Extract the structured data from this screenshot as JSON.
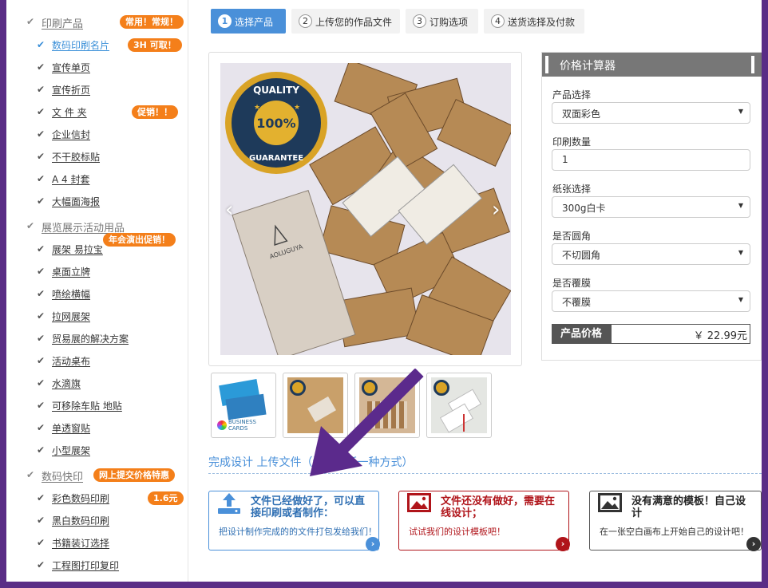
{
  "sidebar": {
    "categories": [
      {
        "label": "印刷产品",
        "badge": "常用！常规！"
      },
      {
        "label": "展览展示活动用品",
        "badge": "年会演出促销！"
      },
      {
        "label": "数码快印",
        "badge": "网上提交价格特惠"
      }
    ],
    "items": [
      {
        "label": "数码印刷名片",
        "badge": "3H 可取！"
      },
      {
        "label": "宣传单页"
      },
      {
        "label": "宣传折页"
      },
      {
        "label": "文 件 夹",
        "badge": "促销！！"
      },
      {
        "label": "企业信封"
      },
      {
        "label": "不干胶标贴"
      },
      {
        "label": "A 4 封套"
      },
      {
        "label": "大幅面海报"
      },
      {
        "label": "展架 易拉宝"
      },
      {
        "label": "桌面立牌"
      },
      {
        "label": "喷绘横幅"
      },
      {
        "label": "拉网展架"
      },
      {
        "label": "贸易展的解决方案"
      },
      {
        "label": "活动桌布"
      },
      {
        "label": "水滴旗"
      },
      {
        "label": "可移除车贴 地贴"
      },
      {
        "label": "单透窗贴"
      },
      {
        "label": "小型展架"
      },
      {
        "label": "彩色数码印刷",
        "badge": "1.6元"
      },
      {
        "label": "黑白数码印刷"
      },
      {
        "label": "书籍装订选择"
      },
      {
        "label": "工程图打印复印"
      }
    ]
  },
  "steps": [
    {
      "num": "1",
      "label": "选择产品"
    },
    {
      "num": "2",
      "label": "上传您的作品文件"
    },
    {
      "num": "3",
      "label": "订购选项"
    },
    {
      "num": "4",
      "label": "送货选择及付款"
    }
  ],
  "gallery": {
    "seal_top": "QUALITY",
    "seal_mid": "100%",
    "seal_bottom": "GUARANTEE",
    "card_brand": "AOLUGUYA",
    "thumb1_brand": "BUSINESS CARDS"
  },
  "calculator": {
    "title": "价格计算器",
    "fields": {
      "product": {
        "label": "产品选择",
        "value": "双面彩色"
      },
      "quantity": {
        "label": "印刷数量",
        "value": "1"
      },
      "paper": {
        "label": "纸张选择",
        "value": "300g白卡"
      },
      "corner": {
        "label": "是否圆角",
        "value": "不切圆角"
      },
      "laminate": {
        "label": "是否覆膜",
        "value": "不覆膜"
      }
    },
    "price_label": "产品价格",
    "price_value": "￥ 22.99元"
  },
  "upload": {
    "title": "完成设计 上传文件（请选择任一种方式）",
    "options": [
      {
        "heading": "文件已经做好了，可以直接印刷或者制作：",
        "desc": "把设计制作完成的的文件打包发给我们！"
      },
      {
        "heading": "文件还没有做好，需要在线设计；",
        "desc": "试试我们的设计模板吧！"
      },
      {
        "heading": "没有满意的模板！自己设计",
        "desc": "在一张空白画布上开始自己的设计吧！"
      }
    ]
  },
  "colors": {
    "frame_bg": "#5a2d86",
    "accent_blue": "#4a90d9",
    "badge_orange": "#f47f1a",
    "option_red": "#b0141a",
    "arrow_purple": "#5b2a8c"
  },
  "icons": {
    "check": "check-icon",
    "upload": "upload-icon",
    "image": "image-icon",
    "go": "chevron-right-icon"
  }
}
